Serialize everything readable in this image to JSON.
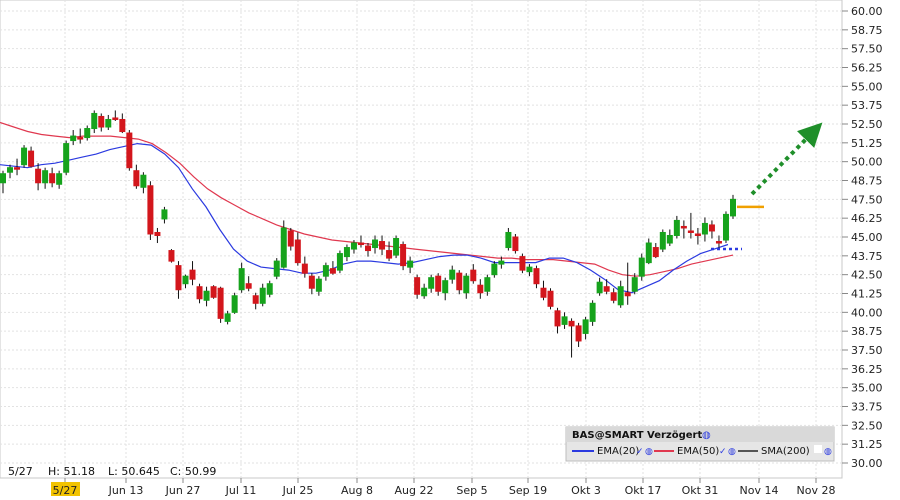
{
  "chart_data": {
    "type": "candlestick",
    "symbol_label": "BAS@SMART Verzögert",
    "ylim": [
      30.0,
      60.0
    ],
    "y_ticks": [
      "60.00",
      "58.75",
      "57.50",
      "56.25",
      "55.00",
      "53.75",
      "52.50",
      "51.25",
      "50.00",
      "48.75",
      "47.50",
      "46.25",
      "45.00",
      "43.75",
      "42.50",
      "41.25",
      "40.00",
      "38.75",
      "37.50",
      "36.25",
      "35.00",
      "33.75",
      "32.50",
      "31.25",
      "30.00"
    ],
    "x_ticks": [
      "5/27",
      "Jun 13",
      "Jun 27",
      "Jul 11",
      "Jul 25",
      "Aug 8",
      "Aug 22",
      "Sep 5",
      "Sep 19",
      "Okt 3",
      "Okt 17",
      "Okt 31",
      "Nov 14",
      "Nov 28"
    ],
    "ohlc_readout": {
      "date": "5/27",
      "high": "H: 51.18",
      "low": "L: 50.645",
      "close": "C: 50.99"
    },
    "legend": [
      {
        "label": "EMA(20)",
        "color": "#2b3ae0"
      },
      {
        "label": "EMA(50)",
        "color": "#e0384f"
      },
      {
        "label": "SMA(200)",
        "color": "#555555"
      }
    ],
    "candles": [
      [
        48.6,
        49.4,
        47.9,
        49.2
      ],
      [
        49.3,
        49.8,
        48.9,
        49.6
      ],
      [
        49.6,
        50.2,
        49.1,
        49.5
      ],
      [
        49.8,
        51.1,
        49.6,
        50.9
      ],
      [
        50.7,
        51.0,
        49.6,
        49.7
      ],
      [
        49.5,
        49.9,
        48.1,
        48.6
      ],
      [
        48.6,
        49.6,
        48.2,
        49.4
      ],
      [
        49.2,
        49.6,
        48.3,
        48.6
      ],
      [
        48.5,
        49.4,
        48.2,
        49.2
      ],
      [
        49.3,
        51.4,
        49.1,
        51.2
      ],
      [
        51.4,
        52.1,
        51.1,
        51.7
      ],
      [
        51.6,
        52.2,
        51.2,
        51.5
      ],
      [
        51.6,
        52.4,
        51.4,
        52.2
      ],
      [
        52.2,
        53.4,
        51.9,
        53.2
      ],
      [
        53.0,
        53.2,
        52.0,
        52.3
      ],
      [
        52.3,
        53.1,
        52.1,
        52.8
      ],
      [
        52.9,
        53.4,
        52.7,
        52.8
      ],
      [
        52.8,
        53.2,
        51.9,
        52.0
      ],
      [
        51.9,
        52.1,
        49.4,
        49.6
      ],
      [
        49.4,
        49.8,
        48.2,
        48.4
      ],
      [
        48.3,
        49.3,
        47.9,
        49.1
      ],
      [
        48.4,
        48.7,
        44.8,
        45.2
      ],
      [
        45.3,
        45.6,
        44.6,
        45.1
      ],
      [
        46.2,
        47.0,
        45.9,
        46.8
      ],
      [
        44.1,
        44.2,
        43.3,
        43.4
      ],
      [
        43.1,
        43.4,
        40.9,
        41.5
      ],
      [
        41.9,
        42.5,
        41.6,
        42.4
      ],
      [
        42.8,
        43.4,
        41.8,
        42.2
      ],
      [
        41.7,
        41.9,
        40.6,
        40.9
      ],
      [
        40.8,
        41.7,
        40.4,
        41.4
      ],
      [
        41.7,
        41.8,
        40.9,
        41.0
      ],
      [
        41.6,
        41.7,
        39.3,
        39.6
      ],
      [
        39.4,
        40.1,
        39.2,
        39.9
      ],
      [
        40.0,
        41.3,
        39.9,
        41.1
      ],
      [
        41.5,
        43.3,
        41.3,
        42.9
      ],
      [
        41.9,
        42.4,
        41.4,
        41.6
      ],
      [
        41.1,
        41.3,
        40.2,
        40.6
      ],
      [
        40.6,
        41.9,
        40.4,
        41.6
      ],
      [
        41.2,
        42.1,
        41.0,
        41.9
      ],
      [
        42.4,
        43.6,
        42.2,
        43.4
      ],
      [
        43.0,
        46.1,
        42.9,
        45.6
      ],
      [
        45.4,
        45.6,
        44.1,
        44.4
      ],
      [
        44.8,
        45.3,
        43.1,
        43.3
      ],
      [
        43.2,
        43.7,
        42.3,
        42.6
      ],
      [
        42.4,
        42.6,
        41.2,
        41.6
      ],
      [
        41.4,
        42.4,
        41.1,
        42.2
      ],
      [
        42.4,
        43.3,
        42.1,
        43.1
      ],
      [
        42.9,
        43.4,
        42.5,
        42.6
      ],
      [
        42.8,
        44.1,
        42.6,
        43.9
      ],
      [
        43.7,
        44.5,
        43.4,
        44.3
      ],
      [
        44.2,
        44.8,
        43.9,
        44.6
      ],
      [
        44.6,
        45.1,
        44.3,
        44.5
      ],
      [
        44.4,
        44.6,
        43.7,
        44.1
      ],
      [
        44.3,
        45.1,
        43.9,
        44.8
      ],
      [
        44.7,
        45.1,
        43.8,
        44.2
      ],
      [
        44.1,
        44.7,
        43.4,
        43.6
      ],
      [
        43.8,
        45.1,
        43.6,
        44.9
      ],
      [
        44.5,
        44.7,
        42.8,
        43.1
      ],
      [
        43.0,
        43.7,
        42.6,
        43.4
      ],
      [
        42.3,
        42.5,
        40.9,
        41.2
      ],
      [
        41.1,
        41.9,
        40.9,
        41.6
      ],
      [
        41.6,
        42.5,
        41.3,
        42.3
      ],
      [
        42.4,
        42.6,
        41.1,
        41.4
      ],
      [
        41.3,
        42.3,
        40.8,
        42.1
      ],
      [
        42.2,
        43.1,
        41.9,
        42.8
      ],
      [
        42.6,
        42.8,
        41.2,
        41.5
      ],
      [
        41.3,
        42.6,
        40.9,
        42.4
      ],
      [
        42.8,
        43.2,
        41.9,
        42.1
      ],
      [
        41.8,
        42.2,
        40.9,
        41.3
      ],
      [
        41.4,
        42.5,
        41.1,
        42.3
      ],
      [
        42.5,
        43.4,
        42.3,
        43.2
      ],
      [
        43.2,
        43.7,
        42.9,
        43.4
      ],
      [
        44.3,
        45.6,
        44.1,
        45.3
      ],
      [
        45.0,
        45.2,
        43.9,
        44.1
      ],
      [
        43.7,
        43.9,
        42.6,
        42.8
      ],
      [
        42.7,
        43.2,
        42.4,
        43.0
      ],
      [
        42.9,
        43.1,
        41.6,
        41.9
      ],
      [
        41.6,
        42.1,
        40.8,
        41.0
      ],
      [
        41.4,
        41.6,
        40.2,
        40.4
      ],
      [
        40.1,
        40.3,
        38.6,
        39.1
      ],
      [
        39.2,
        40.0,
        38.9,
        39.7
      ],
      [
        39.4,
        39.6,
        37.0,
        39.1
      ],
      [
        39.1,
        39.3,
        37.7,
        38.1
      ],
      [
        38.6,
        39.7,
        38.2,
        39.5
      ],
      [
        39.4,
        40.8,
        39.1,
        40.6
      ],
      [
        41.3,
        42.3,
        41.1,
        42.0
      ],
      [
        41.7,
        42.2,
        41.2,
        41.4
      ],
      [
        41.3,
        41.6,
        40.6,
        40.8
      ],
      [
        40.5,
        42.1,
        40.3,
        41.7
      ],
      [
        41.3,
        43.3,
        40.5,
        41.1
      ],
      [
        41.4,
        42.6,
        41.2,
        42.3
      ],
      [
        42.4,
        43.9,
        42.1,
        43.6
      ],
      [
        43.3,
        44.9,
        43.2,
        44.6
      ],
      [
        44.3,
        44.6,
        43.6,
        43.7
      ],
      [
        44.2,
        45.5,
        44.0,
        45.3
      ],
      [
        44.6,
        45.5,
        44.4,
        45.1
      ],
      [
        45.1,
        46.4,
        44.9,
        46.1
      ],
      [
        45.7,
        46.1,
        44.9,
        45.6
      ],
      [
        45.4,
        46.6,
        44.9,
        45.3
      ],
      [
        45.2,
        45.6,
        44.5,
        45.1
      ],
      [
        45.2,
        46.3,
        44.7,
        45.9
      ],
      [
        45.8,
        46.1,
        44.9,
        45.4
      ],
      [
        44.7,
        45.1,
        44.2,
        44.6
      ],
      [
        44.8,
        46.7,
        44.6,
        46.5
      ],
      [
        46.4,
        47.8,
        46.2,
        47.5
      ]
    ],
    "ema20": [
      49.8,
      49.7,
      49.6,
      49.8,
      49.9,
      50.1,
      50.3,
      50.5,
      50.8,
      51.0,
      51.2,
      51.1,
      50.5,
      49.6,
      48.2,
      47.0,
      45.5,
      44.2,
      43.4,
      43.0,
      42.9,
      42.8,
      42.6,
      42.6,
      42.8,
      43.2,
      43.4,
      43.4,
      43.3,
      43.2,
      43.3,
      43.5,
      43.7,
      43.8,
      43.8,
      43.6,
      43.3,
      43.3,
      43.3,
      43.3,
      43.6,
      43.6,
      43.3,
      42.8,
      42.2,
      41.5,
      41.3,
      41.7,
      42.1,
      42.8,
      43.4,
      43.9,
      44.2,
      44.5
    ],
    "ema50": [
      52.6,
      52.3,
      52.0,
      51.8,
      51.7,
      51.6,
      51.7,
      51.7,
      51.7,
      51.6,
      51.5,
      51.2,
      50.6,
      49.9,
      49.0,
      48.2,
      47.6,
      47.1,
      46.6,
      46.2,
      45.8,
      45.5,
      45.2,
      45.0,
      44.8,
      44.7,
      44.6,
      44.5,
      44.4,
      44.3,
      44.2,
      44.1,
      44.0,
      43.9,
      43.8,
      43.7,
      43.6,
      43.6,
      43.5,
      43.5,
      43.5,
      43.4,
      43.3,
      43.2,
      42.8,
      42.5,
      42.4,
      42.5,
      42.7,
      42.9,
      43.2,
      43.4,
      43.6,
      43.8
    ],
    "resistance_level": 47.0,
    "support_level": 44.2
  }
}
